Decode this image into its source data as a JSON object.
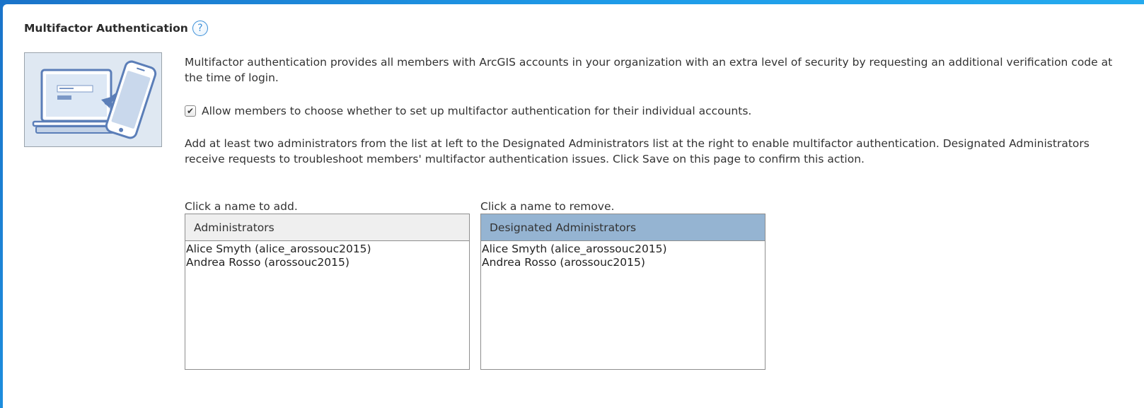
{
  "section": {
    "title": "Multifactor Authentication",
    "help_glyph": "?"
  },
  "intro_text": "Multifactor authentication provides all members with ArcGIS accounts in your organization with an extra level of security by requesting an additional verification code at the time of login.",
  "allow_members_option": {
    "label": "Allow members to choose whether to set up multifactor authentication for their individual accounts.",
    "checked": true,
    "check_glyph": "✔"
  },
  "instructions_text": "Add at least two administrators from the list at left to the Designated Administrators list at the right to enable multifactor authentication. Designated Administrators receive requests to troubleshoot members' multifactor authentication issues. Click Save on this page to confirm this action.",
  "administrators_list": {
    "hint": "Click a name to add.",
    "header": "Administrators",
    "items": [
      "Alice Smyth (alice_arossouc2015)",
      "Andrea Rosso (arossouc2015)"
    ]
  },
  "designated_list": {
    "hint": "Click a name to remove.",
    "header": "Designated Administrators",
    "items": [
      "Alice Smyth (alice_arossouc2015)",
      "Andrea Rosso (arossouc2015)"
    ]
  },
  "colors": {
    "designated_header": "#95b4d2",
    "admins_header": "#efefef",
    "help_icon": "#3c8fd8",
    "page_background_accent": "#1e9be8"
  },
  "icons": {
    "help": "help-icon",
    "illustration": "multifactor-illustration-icon"
  }
}
